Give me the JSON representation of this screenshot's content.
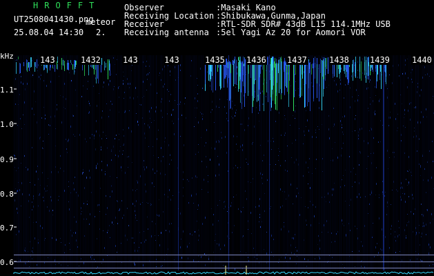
{
  "header": {
    "brand": "HROFFT",
    "filename": "UT2508041430.png",
    "tag": "meteor",
    "datetime": "25.08.04 14:30",
    "count": "2.",
    "info_labels": [
      "Observer",
      "Receiving Location",
      "Receiver",
      "Receiving antenna"
    ],
    "info_values": [
      ":Masaki Kano",
      ":Shibukawa,Gunma,Japan",
      ":RTL-SDR SDR# 43dB L15 114.1MHz USB",
      ":5el Yagi Az 20 for Aomori VOR"
    ]
  },
  "axis": {
    "y_unit": "kHz",
    "y_ticks": [
      "1.1",
      "1.0",
      "0.9",
      "0.8",
      "0.7",
      "0.6"
    ],
    "x_ticks": [
      "143",
      "1432",
      "143",
      "143",
      "1435",
      "1436",
      "1437",
      "1438",
      "1439",
      "1440"
    ]
  },
  "colors": {
    "background": "#000000",
    "noise": "#0a1a78",
    "echo_green": "#2fe05a",
    "echo_cyan": "#35d8ff",
    "baseline": "#8a94c8"
  }
}
